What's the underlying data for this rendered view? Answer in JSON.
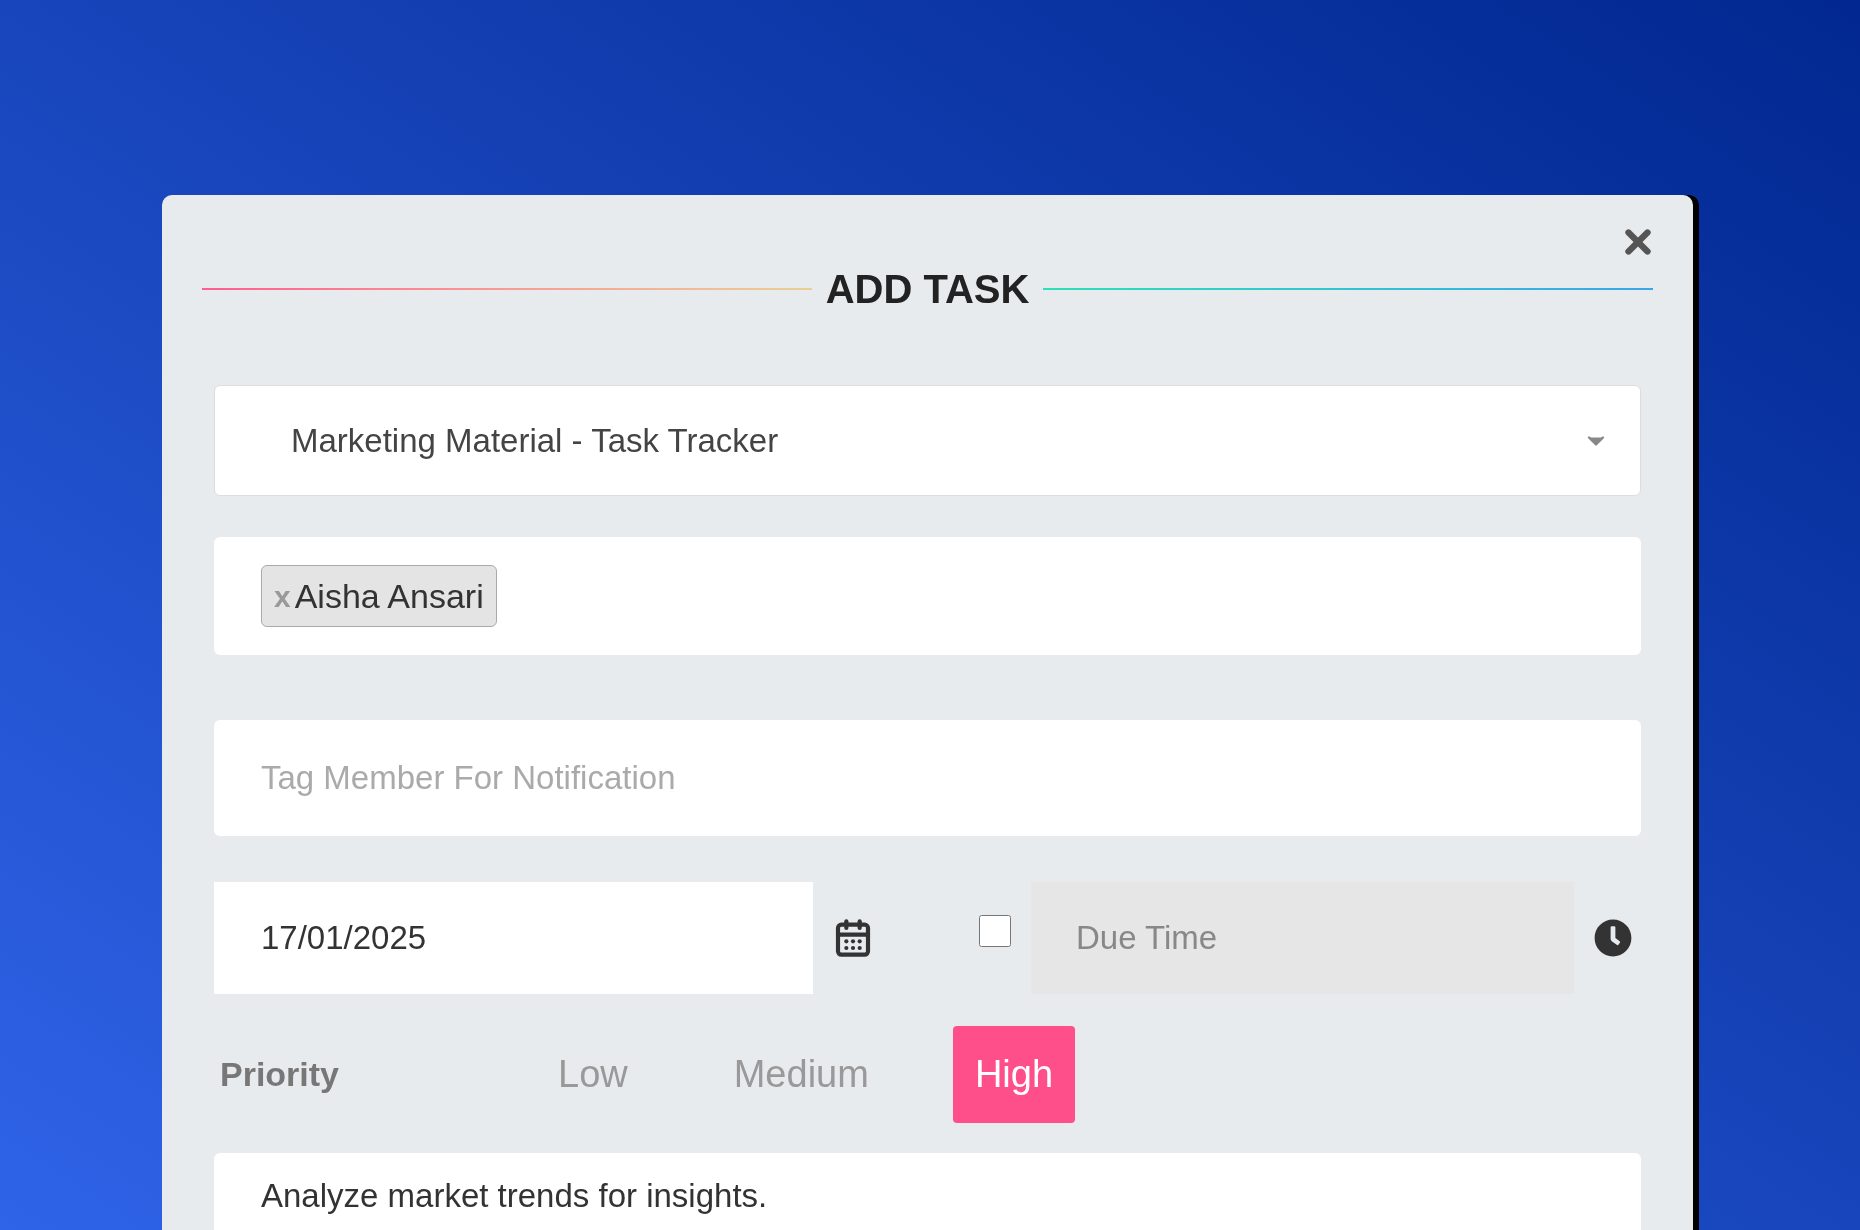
{
  "dialog": {
    "title": "ADD TASK"
  },
  "project_select": {
    "value": "Marketing Material - Task Tracker"
  },
  "assignees": [
    {
      "remove": "x",
      "name": "Aisha Ansari"
    }
  ],
  "notify_field": {
    "placeholder": "Tag Member For Notification"
  },
  "due_date": {
    "value": "17/01/2025"
  },
  "due_time": {
    "checked": false,
    "disabled": true,
    "placeholder": "Due Time"
  },
  "priority": {
    "label": "Priority",
    "options": [
      {
        "label": "Low",
        "selected": false
      },
      {
        "label": "Medium",
        "selected": false
      },
      {
        "label": "High",
        "selected": true
      }
    ]
  },
  "description": {
    "value": "Analyze market trends for insights."
  }
}
